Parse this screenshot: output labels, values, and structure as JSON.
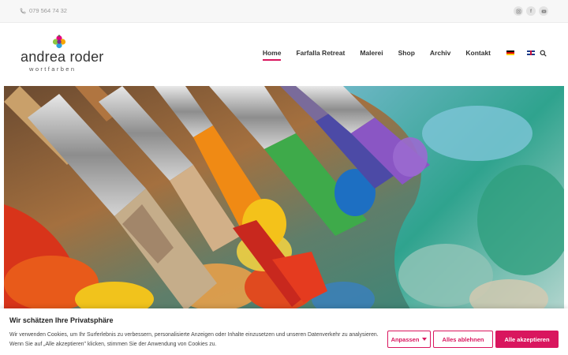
{
  "topbar": {
    "phone": "079 564 74 32",
    "socials": [
      {
        "icon": "instagram-icon"
      },
      {
        "icon": "facebook-icon",
        "glyph": "f"
      },
      {
        "icon": "youtube-icon"
      }
    ]
  },
  "logo": {
    "name": "andrea roder",
    "subtitle": "wortfarben"
  },
  "nav": {
    "items": [
      {
        "label": "Home",
        "active": true
      },
      {
        "label": "Farfalla Retreat"
      },
      {
        "label": "Malerei"
      },
      {
        "label": "Shop"
      },
      {
        "label": "Archiv"
      },
      {
        "label": "Kontakt"
      }
    ]
  },
  "cookie": {
    "title": "Wir schätzen Ihre Privatsphäre",
    "text_line1": "Wir verwenden Cookies, um Ihr Surferlebnis zu verbessern, personalisierte Anzeigen oder Inhalte einzusetzen und unseren Datenverkehr zu analysieren.",
    "text_line2": "Wenn Sie auf „Alle akzeptieren\" klicken, stimmen Sie der Anwendung von Cookies zu.",
    "customize_label": "Anpassen",
    "reject_label": "Alles ablehnen",
    "accept_label": "Alle akzeptieren"
  },
  "colors": {
    "accent": "#d9165e"
  }
}
